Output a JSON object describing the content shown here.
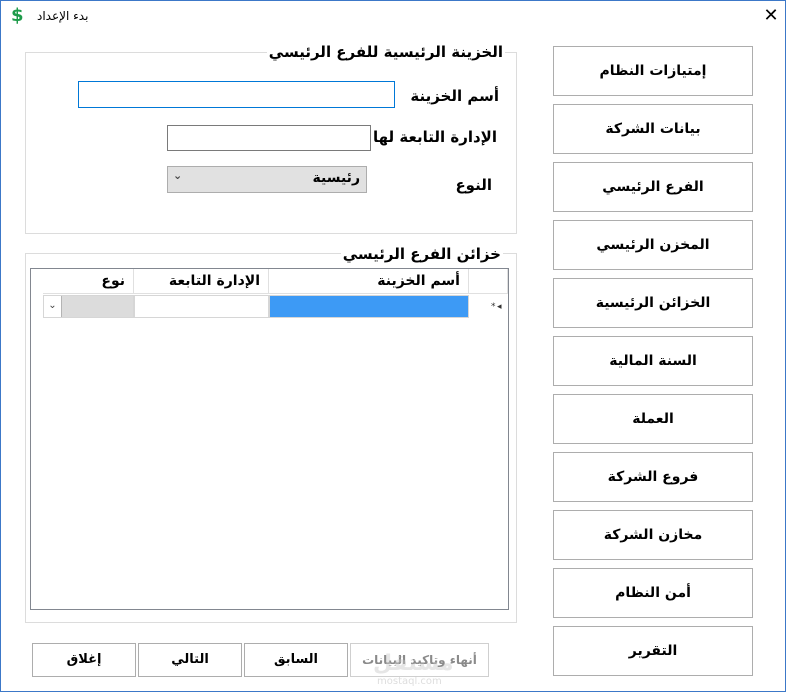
{
  "window": {
    "title": "بدء الإعداد",
    "icon": "dollar-icon",
    "close_glyph": "✕"
  },
  "main_treasury": {
    "group_title": "الخزينة الرئيسية للفرع الرئيسي",
    "name_label": "أسم الخزينة",
    "name_value": "",
    "dept_label": "الإدارة التابعة لها",
    "dept_value": "",
    "type_label": "النوع",
    "type_value": "رئيسية"
  },
  "branch_treasuries": {
    "group_title": "خزائن الفرع الرئيسي",
    "columns": [
      "أسم الخزينة",
      "الإدارة التابعة",
      "نوع"
    ],
    "new_row_indicator": "*"
  },
  "side_buttons": [
    "إمتيازات النظام",
    "بيانات الشركة",
    "الفرع الرئيسي",
    "المخزن الرئيسي",
    "الخزائن الرئيسية",
    "السنة المالية",
    "العملة",
    "فروع الشركة",
    "مخازن الشركة",
    "أمن النظام",
    "التقرير"
  ],
  "bottom_buttons": {
    "finish": "أنهاء وتاكيد البيانات",
    "previous": "السابق",
    "next": "التالي",
    "close": "إغلاق"
  },
  "watermark": {
    "text": "مستقل",
    "sub": "mostaql.com"
  },
  "colors": {
    "selection": "#3d9af5",
    "accent_border": "#0078d7",
    "icon_green": "#1e9b4a"
  }
}
